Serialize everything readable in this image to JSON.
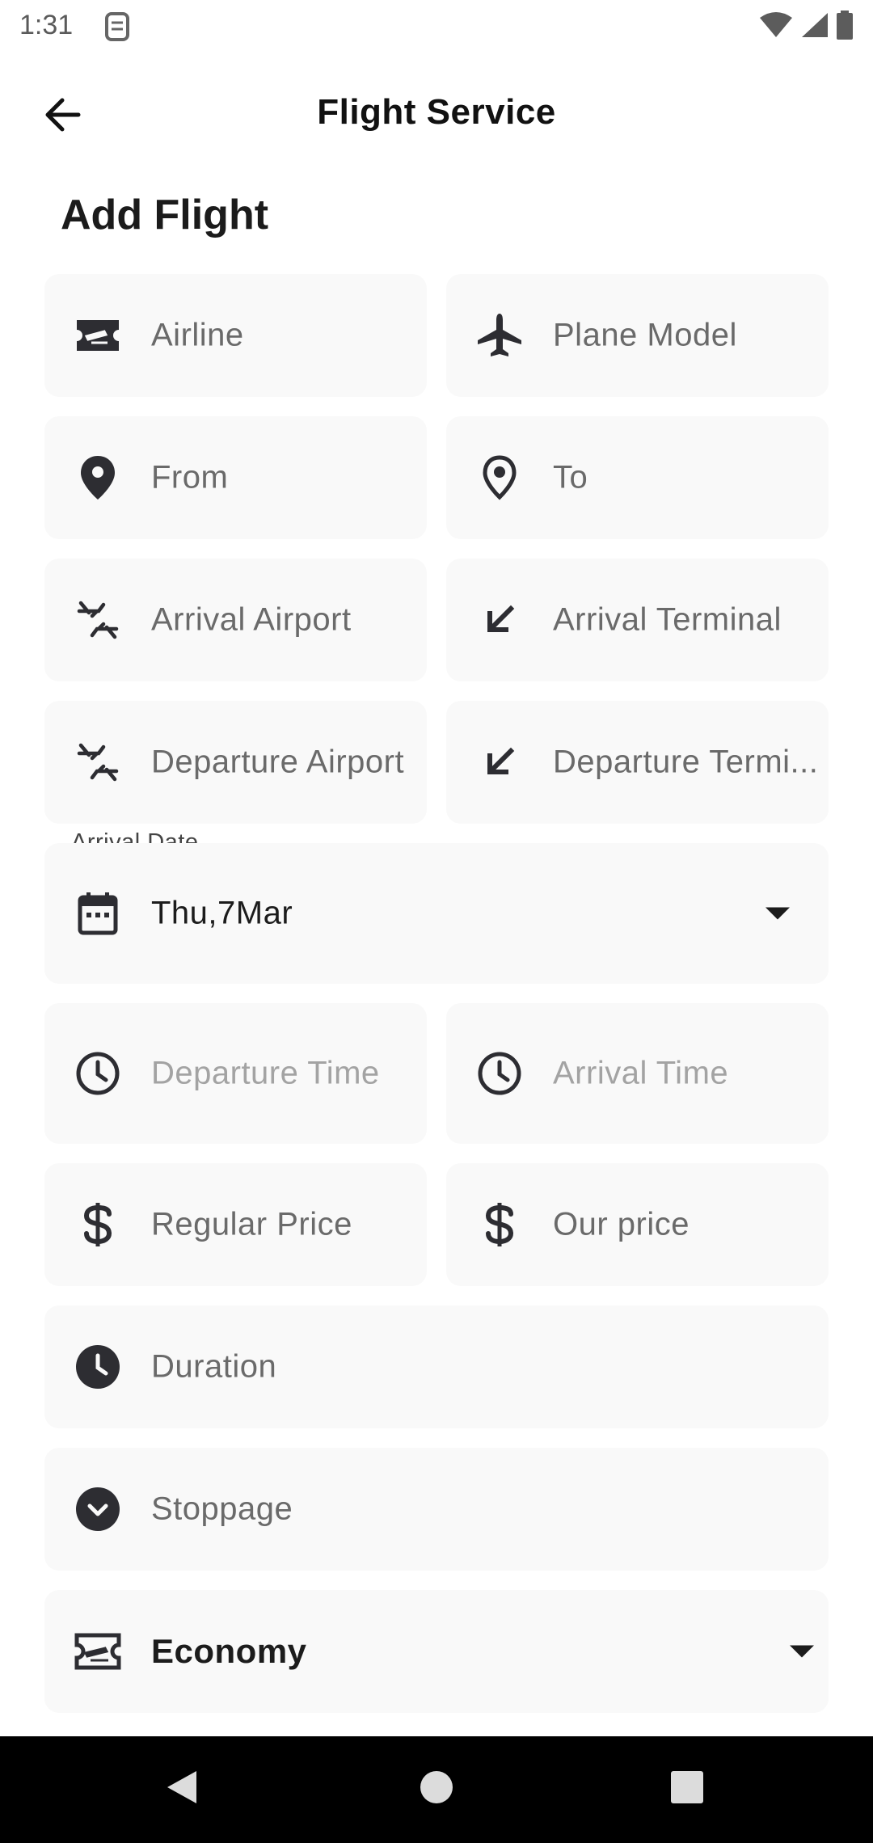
{
  "status_bar": {
    "time": "1:31"
  },
  "app_bar": {
    "title": "Flight Service"
  },
  "section_title": "Add Flight",
  "fields": {
    "airline": {
      "placeholder": "Airline",
      "icon": "ticket-icon"
    },
    "plane_model": {
      "placeholder": "Plane Model",
      "icon": "airplane-icon"
    },
    "from": {
      "placeholder": "From",
      "icon": "location-pin-filled-icon"
    },
    "to": {
      "placeholder": "To",
      "icon": "location-pin-outline-icon"
    },
    "arrival_airport": {
      "placeholder": "Arrival Airport",
      "icon": "connecting-airports-icon"
    },
    "arrival_terminal": {
      "placeholder": "Arrival Terminal",
      "icon": "south-west-arrow-icon"
    },
    "departure_airport": {
      "placeholder": "Departure Airport",
      "icon": "connecting-airports-icon"
    },
    "departure_terminal": {
      "placeholder": "Departure Termi...",
      "icon": "south-west-arrow-icon"
    },
    "arrival_date": {
      "label": "Arrival Date",
      "value": "Thu,7Mar",
      "icon": "calendar-icon"
    },
    "departure_time": {
      "placeholder": "Departure Time",
      "icon": "clock-outline-icon"
    },
    "arrival_time": {
      "placeholder": "Arrival Time",
      "icon": "clock-outline-icon"
    },
    "regular_price": {
      "placeholder": "Regular Price",
      "icon": "dollar-icon"
    },
    "our_price": {
      "placeholder": "Our price",
      "icon": "dollar-icon"
    },
    "duration": {
      "placeholder": "Duration",
      "icon": "clock-filled-icon"
    },
    "stoppage": {
      "placeholder": "Stoppage",
      "icon": "chevron-circle-icon"
    },
    "class": {
      "value": "Economy",
      "icon": "flight-class-icon"
    }
  },
  "colors": {
    "field_bg": "#f9f9f9",
    "icon": "#2d2d32",
    "placeholder": "#6a6a6a",
    "placeholder_light": "#a3a3a3",
    "nav_bg": "#000000"
  }
}
